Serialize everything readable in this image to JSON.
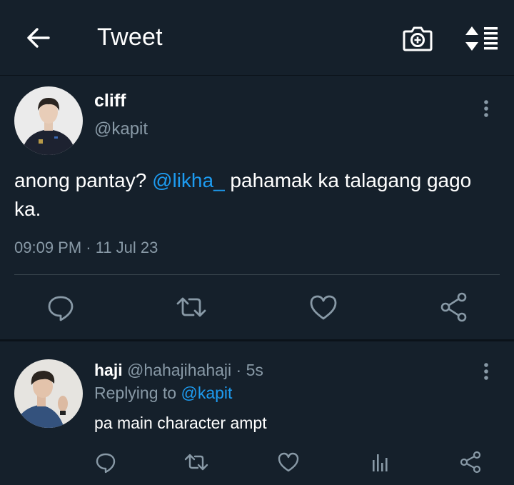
{
  "header": {
    "title": "Tweet",
    "icons": [
      "back-arrow-icon",
      "camera-add-icon",
      "sort-list-icon"
    ]
  },
  "tweet": {
    "author_name": "cliff",
    "author_handle": "@kapit",
    "text_before": "anong pantay? ",
    "mention": "@likha_",
    "text_after": " pahamak ka talagang gago ka.",
    "timestamp": "09:09 PM · 11 Jul 23",
    "actions": [
      "reply-icon",
      "retweet-icon",
      "like-icon",
      "share-icon"
    ]
  },
  "reply": {
    "author_name": "haji",
    "author_handle": "@hahajihahaji",
    "time": "· 5s",
    "replying_to_label": "Replying to",
    "replying_to_handle": "@kapit",
    "text": "pa main character ampt",
    "actions": [
      "reply-icon",
      "retweet-icon",
      "like-icon",
      "analytics-icon",
      "share-icon"
    ]
  },
  "colors": {
    "background": "#15202b",
    "accent": "#1d9bf0",
    "secondary_text": "#8899a6",
    "divider": "#38444d"
  }
}
